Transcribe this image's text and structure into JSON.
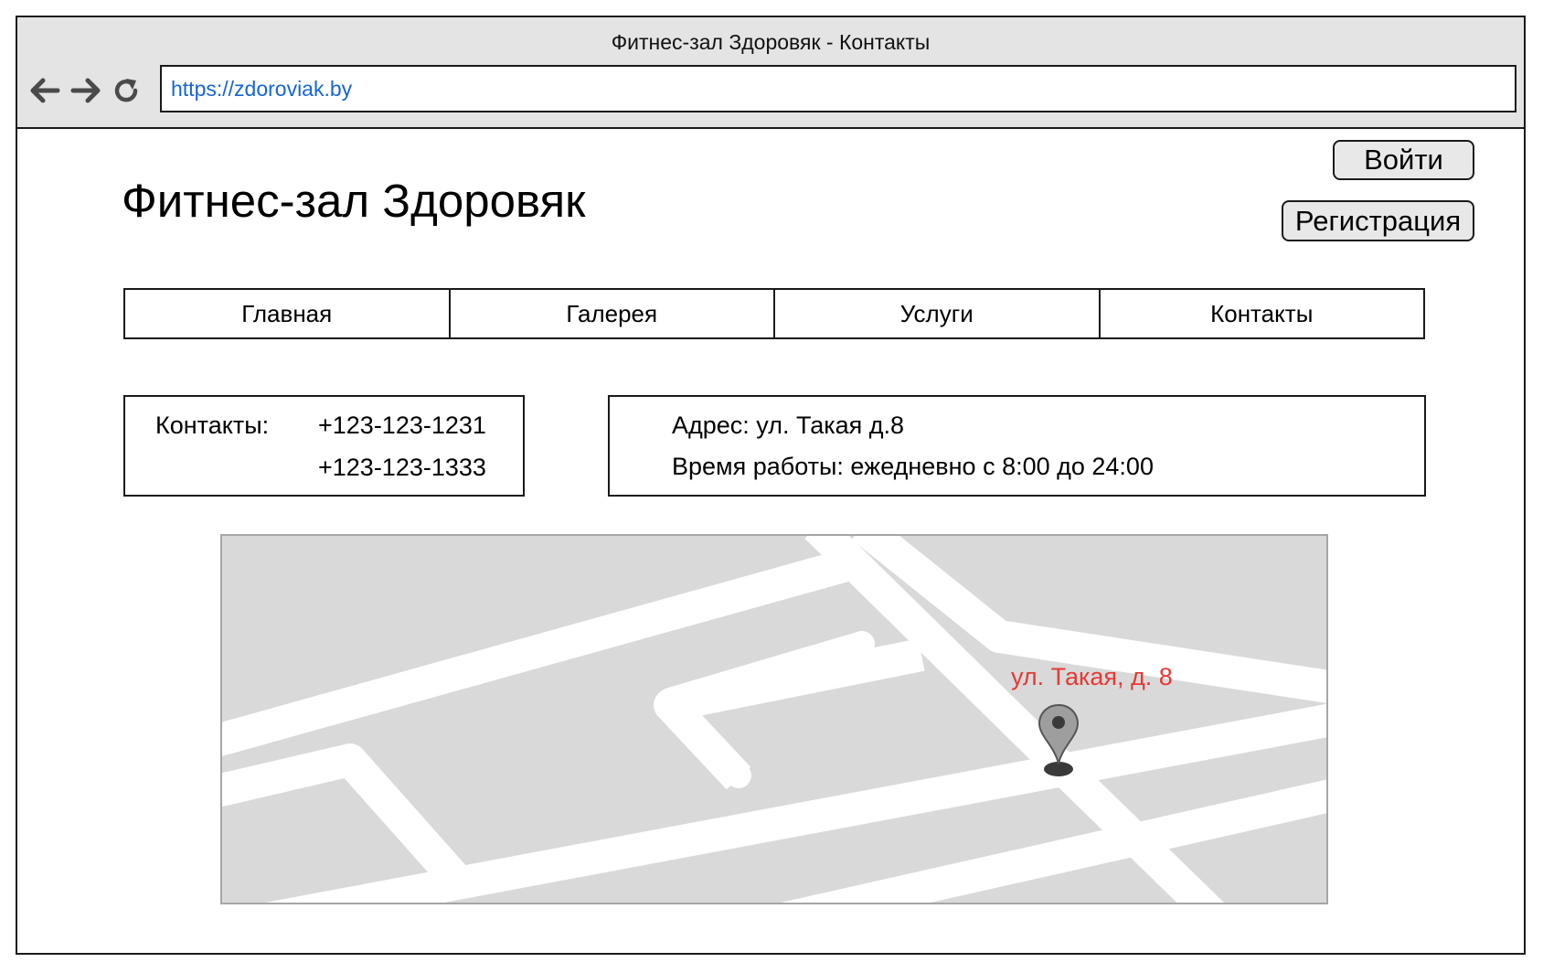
{
  "window": {
    "title": "Фитнес-зал Здоровяк - Контакты"
  },
  "browser": {
    "url": "https://zdoroviak.by"
  },
  "site": {
    "title": "Фитнес-зал Здоровяк"
  },
  "auth": {
    "login_label": "Войти",
    "register_label": "Регистрация"
  },
  "menu": {
    "items": [
      {
        "label": "Главная"
      },
      {
        "label": "Галерея"
      },
      {
        "label": "Услуги"
      },
      {
        "label": "Контакты"
      }
    ]
  },
  "contacts": {
    "label": "Контакты:",
    "phones": [
      "+123-123-1231",
      "+123-123-1333"
    ]
  },
  "info": {
    "address": "Адрес: ул. Такая д.8",
    "hours": "Время работы: ежедневно с 8:00 до 24:00"
  },
  "map": {
    "marker_label": "ул. Такая, д. 8",
    "marker_color": "#e53935",
    "background_color": "#d9d9d9",
    "road_color": "#ffffff"
  },
  "icons": {
    "back": "arrow-left-icon",
    "forward": "arrow-right-icon",
    "reload": "reload-icon",
    "marker": "map-pin-icon"
  }
}
